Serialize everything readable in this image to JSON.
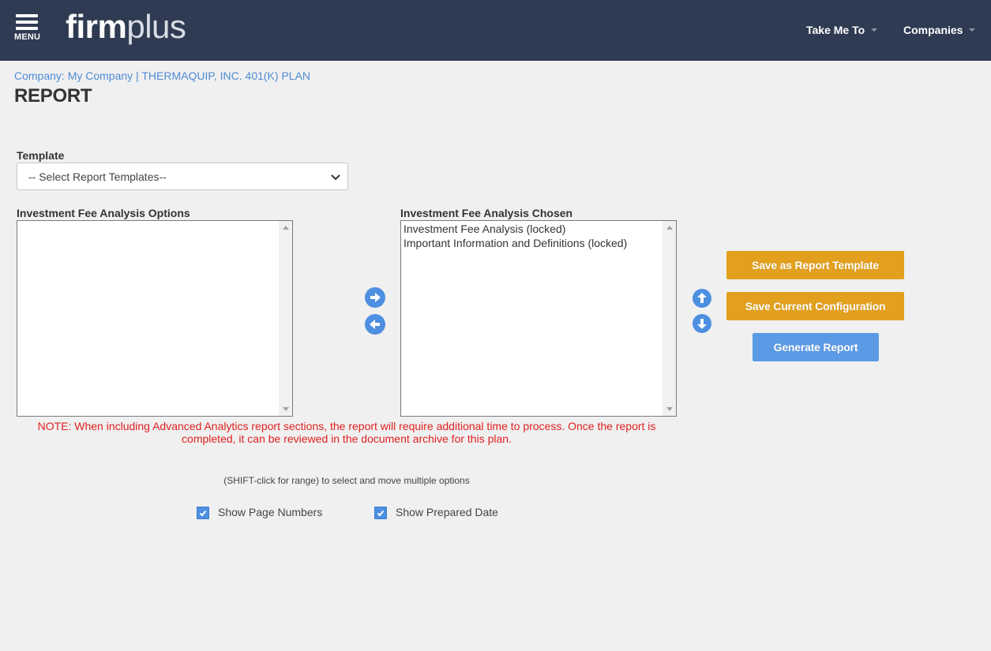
{
  "header": {
    "menu_label": "MENU",
    "logo_primary": "firm",
    "logo_secondary": "plus",
    "nav": [
      {
        "label": "Take Me To"
      },
      {
        "label": "Companies"
      }
    ]
  },
  "breadcrumb": "Company: My Company | THERMAQUIP, INC. 401(K) PLAN",
  "page_title": "REPORT",
  "template": {
    "label": "Template",
    "selected": "-- Select Report Templates--"
  },
  "options_list": {
    "label": "Investment Fee Analysis Options",
    "items": []
  },
  "chosen_list": {
    "label": "Investment Fee Analysis Chosen",
    "items": [
      "Investment Fee Analysis (locked)",
      "Important Information and Definitions (locked)"
    ]
  },
  "buttons": {
    "save_template": "Save as Report Template",
    "save_config": "Save Current Configuration",
    "generate": "Generate Report"
  },
  "note": "NOTE: When including Advanced Analytics report sections, the report will require additional time to process. Once the report is completed, it can be reviewed in the document archive for this plan.",
  "hint": "(SHIFT-click for range) to select and move multiple options",
  "checkboxes": [
    {
      "label": "Show Page Numbers",
      "checked": true
    },
    {
      "label": "Show Prepared Date",
      "checked": true
    }
  ],
  "colors": {
    "header_bg": "#2f3b52",
    "accent_blue": "#4d8fe0",
    "button_orange": "#e3a01e",
    "note_red": "#e02020",
    "link_blue": "#4f8bd4"
  }
}
